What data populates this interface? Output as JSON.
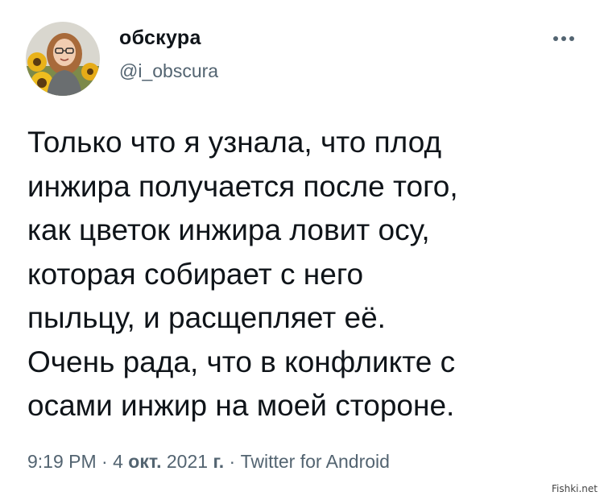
{
  "user": {
    "display_name": "обскура",
    "handle": "@i_obscura"
  },
  "tweet": {
    "text": "Только что я узнала, что плод\nинжира получается после того,\nкак цветок инжира ловит осу,\nкоторая собирает с него\nпыльцу, и расщепляет её.\nОчень рада, что в конфликте с\nосами инжир на моей стороне.",
    "time": "9:19 PM",
    "separator": "·",
    "date_day": "4",
    "date_month": "окт.",
    "date_year": "2021",
    "date_year_suffix": "г.",
    "source": "Twitter for Android"
  },
  "icons": {
    "more": "more-horizontal-icon",
    "avatar": "avatar-photo"
  },
  "colors": {
    "text": "#0f1419",
    "secondary": "#536471"
  },
  "watermark": "Fishki.net"
}
